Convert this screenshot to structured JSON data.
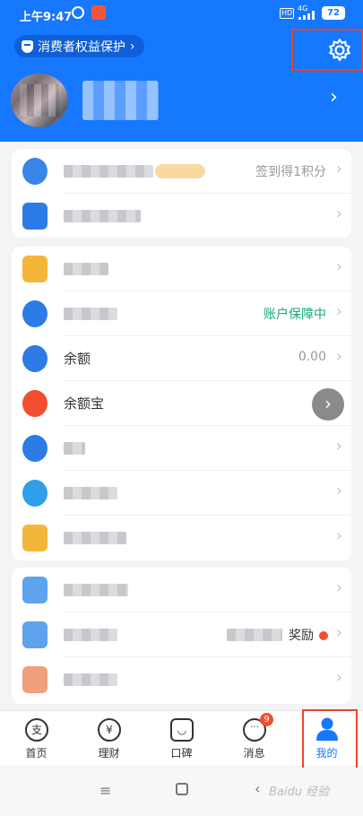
{
  "status_bar": {
    "time": "上午9:47",
    "network": "4G",
    "battery": "72"
  },
  "header": {
    "consumer_protection": "消费者权益保护",
    "settings_icon": "gear-icon"
  },
  "rows": {
    "signin_value": "签到得1积分",
    "safety_value": "账户保障中",
    "balance_label": "余额",
    "balance_value": "0.00",
    "yuebao_label": "余额宝",
    "reward_value": "奖励"
  },
  "tabs": [
    {
      "label": "首页",
      "icon": "支"
    },
    {
      "label": "理财",
      "icon": "¥"
    },
    {
      "label": "口碑",
      "icon": "◡"
    },
    {
      "label": "消息",
      "icon": "···"
    },
    {
      "label": "我的",
      "icon": "person"
    }
  ],
  "messages_badge": "9",
  "watermark": "Baidu 经验",
  "colors": {
    "brand_blue": "#1677ff",
    "green": "#19a974",
    "highlight": "#e8452c"
  }
}
